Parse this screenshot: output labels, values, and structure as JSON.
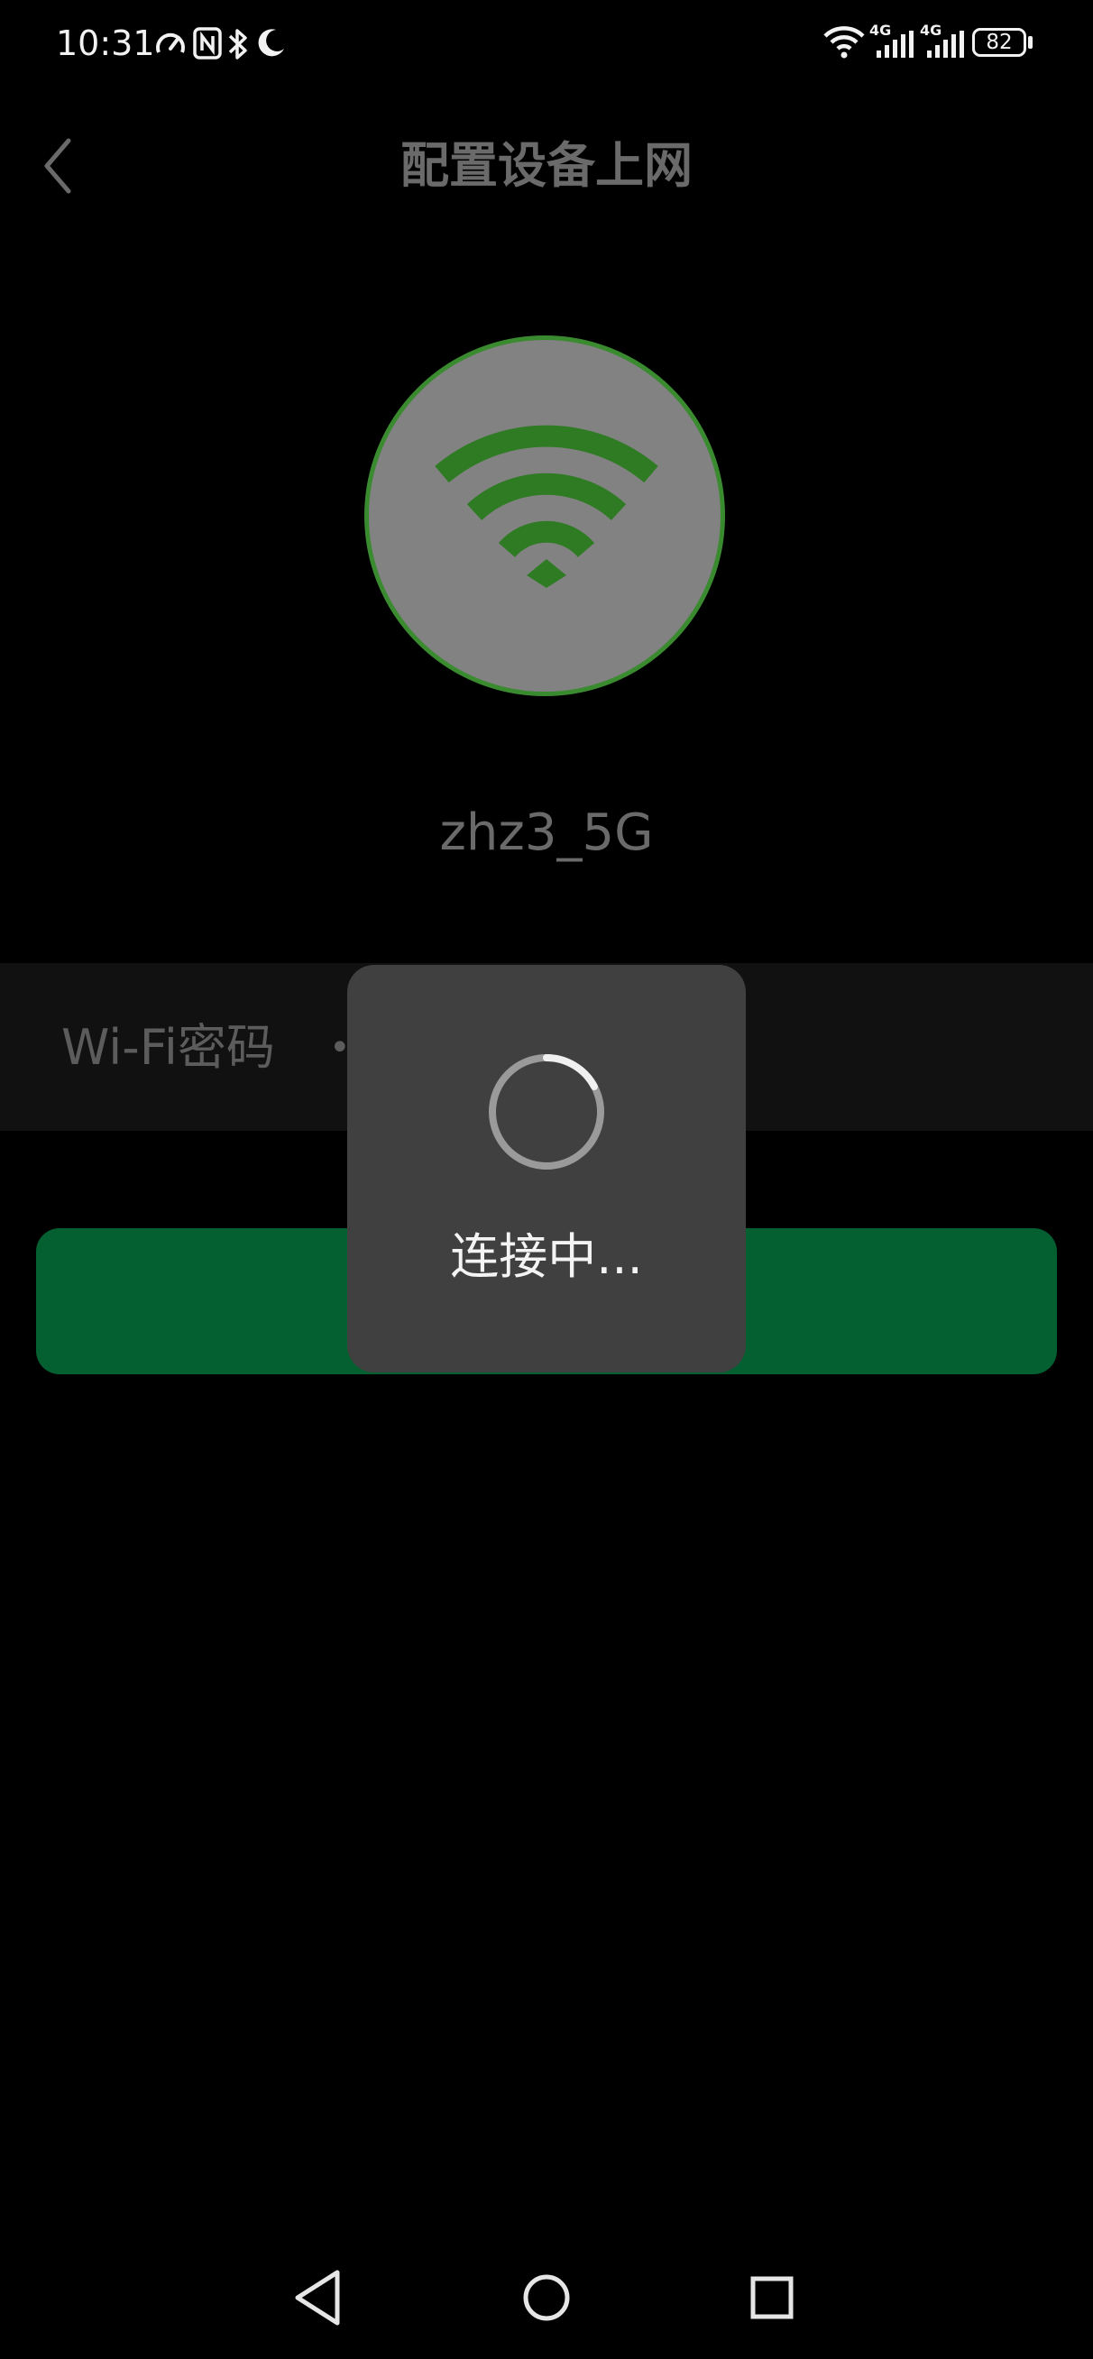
{
  "status_bar": {
    "time": "10:31",
    "icons": [
      "data-saver-icon",
      "nfc-icon",
      "bluetooth-icon",
      "moon-icon",
      "wifi-signal-icon",
      "cell-signal-4g-icon",
      "cell-signal-4g-icon"
    ],
    "network_labels": [
      "4G",
      "4G"
    ],
    "battery_level": "82"
  },
  "header": {
    "back_icon": "chevron-left-icon",
    "title": "配置设备上网"
  },
  "network": {
    "icon": "wifi-icon",
    "ssid": "zhz3_5G"
  },
  "password": {
    "label": "Wi-Fi密码",
    "masked_value": "••••••••••••••"
  },
  "loading_toast": {
    "icon": "loading-spinner-icon",
    "text": "连接中..."
  },
  "nav_bar": {
    "back_icon": "triangle-back-icon",
    "home_icon": "circle-home-icon",
    "recents_icon": "square-recents-icon"
  },
  "colors": {
    "background": "#000000",
    "accent_green": "#3a8a30",
    "button_green": "#045f31",
    "toast_background": "#404040"
  }
}
